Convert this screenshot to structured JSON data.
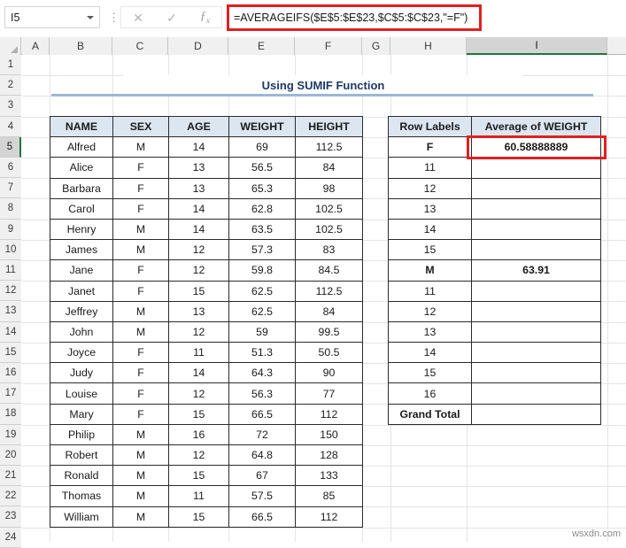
{
  "name_box": {
    "value": "I5",
    "dropdown_icon": "chevron-down-icon"
  },
  "formula_bar": {
    "cancel_icon": "close-icon",
    "confirm_icon": "check-icon",
    "function_icon": "fx-icon",
    "separator": "⋮",
    "formula": "=AVERAGEIFS($E$5:$E$23,$C$5:$C$23,\"=F\")"
  },
  "columns": [
    "A",
    "B",
    "C",
    "D",
    "E",
    "F",
    "G",
    "H",
    "I"
  ],
  "selected_column": "I",
  "rows": [
    "1",
    "2",
    "3",
    "4",
    "5",
    "6",
    "7",
    "8",
    "9",
    "10",
    "11",
    "12",
    "13",
    "14",
    "15",
    "16",
    "17",
    "18",
    "19",
    "20",
    "21",
    "22",
    "23",
    "24"
  ],
  "selected_row": "5",
  "title": "Using SUMIF Function",
  "data_table": {
    "headers": [
      "NAME",
      "SEX",
      "AGE",
      "WEIGHT",
      "HEIGHT"
    ],
    "rows": [
      [
        "Alfred",
        "M",
        "14",
        "69",
        "112.5"
      ],
      [
        "Alice",
        "F",
        "13",
        "56.5",
        "84"
      ],
      [
        "Barbara",
        "F",
        "13",
        "65.3",
        "98"
      ],
      [
        "Carol",
        "F",
        "14",
        "62.8",
        "102.5"
      ],
      [
        "Henry",
        "M",
        "14",
        "63.5",
        "102.5"
      ],
      [
        "James",
        "M",
        "12",
        "57.3",
        "83"
      ],
      [
        "Jane",
        "F",
        "12",
        "59.8",
        "84.5"
      ],
      [
        "Janet",
        "F",
        "15",
        "62.5",
        "112.5"
      ],
      [
        "Jeffrey",
        "M",
        "13",
        "62.5",
        "84"
      ],
      [
        "John",
        "M",
        "12",
        "59",
        "99.5"
      ],
      [
        "Joyce",
        "F",
        "11",
        "51.3",
        "50.5"
      ],
      [
        "Judy",
        "F",
        "14",
        "64.3",
        "90"
      ],
      [
        "Louise",
        "F",
        "12",
        "56.3",
        "77"
      ],
      [
        "Mary",
        "F",
        "15",
        "66.5",
        "112"
      ],
      [
        "Philip",
        "M",
        "16",
        "72",
        "150"
      ],
      [
        "Robert",
        "M",
        "12",
        "64.8",
        "128"
      ],
      [
        "Ronald",
        "M",
        "15",
        "67",
        "133"
      ],
      [
        "Thomas",
        "M",
        "11",
        "57.5",
        "85"
      ],
      [
        "William",
        "M",
        "15",
        "66.5",
        "112"
      ]
    ]
  },
  "pivot_table": {
    "headers": [
      "Row Labels",
      "Average of WEIGHT"
    ],
    "rows": [
      {
        "label": "F",
        "value": "60.58888889",
        "bold": true,
        "total": false
      },
      {
        "label": "11",
        "value": "",
        "bold": false,
        "total": false
      },
      {
        "label": "12",
        "value": "",
        "bold": false,
        "total": false
      },
      {
        "label": "13",
        "value": "",
        "bold": false,
        "total": false
      },
      {
        "label": "14",
        "value": "",
        "bold": false,
        "total": false
      },
      {
        "label": "15",
        "value": "",
        "bold": false,
        "total": false
      },
      {
        "label": "M",
        "value": "63.91",
        "bold": true,
        "total": false
      },
      {
        "label": "11",
        "value": "",
        "bold": false,
        "total": false
      },
      {
        "label": "12",
        "value": "",
        "bold": false,
        "total": false
      },
      {
        "label": "13",
        "value": "",
        "bold": false,
        "total": false
      },
      {
        "label": "14",
        "value": "",
        "bold": false,
        "total": false
      },
      {
        "label": "15",
        "value": "",
        "bold": false,
        "total": false
      },
      {
        "label": "16",
        "value": "",
        "bold": false,
        "total": false
      },
      {
        "label": "Grand Total",
        "value": "",
        "bold": true,
        "total": true
      }
    ]
  },
  "watermark": "wsxdn.com",
  "colors": {
    "header_fill": "#dce6f1",
    "title_text": "#1f3864",
    "title_rule": "#9cb7d6",
    "highlight_red": "#e02020",
    "selection_green": "#217346",
    "grid_line": "#e4e4e4",
    "cell_border": "#2b2b2b"
  }
}
